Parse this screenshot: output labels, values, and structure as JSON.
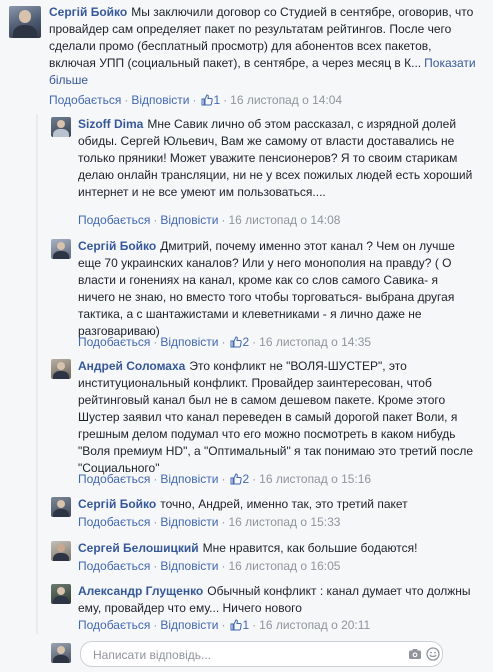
{
  "actions": {
    "like": "Подобається",
    "reply": "Відповісти",
    "separator": "·"
  },
  "comments": [
    {
      "author": "Сергій Бойко",
      "text": "Мы заключили договор со Студией в сентябре, оговорив, что провайдер сам определяет пакет по результатам рейтингов. После чего сделали промо (бесплатный просмотр) для абонентов всех пакетов, включая УПП (социальный пакет), в сентябре, а через месяц в К...",
      "more": "Показати більше",
      "likes": "1",
      "time": "16 листопад о 14:04"
    },
    {
      "author": "Sizoff Dima",
      "text": "Мне Савик лично об этом рассказал, с изрядной долей обиды. Сергей Юльевич, Вам же самому от власти доставались не только пряники! Может уважите пенсионеров? Я то своим старикам делаю онлайн трансляции, ни не у всех пожилых людей есть хороший интернет и не все умеют им пользоваться....",
      "likes": "",
      "time": "16 листопад о 14:08"
    },
    {
      "author": "Сергій Бойко",
      "text": "Дмитрий, почему именно этот канал ? Чем он лучше еще 70 украинских каналов? Или у него монополия на правду? ( О власти и гонениях на канал, кроме как со слов самого Савика- я ничего не знаю, но вместо того чтобы торговаться- выбрана другая тактика, а с шантажистами и клеветниками - я лично даже не разговариваю)",
      "likes": "2",
      "time": "16 листопад о 14:35"
    },
    {
      "author": "Андрей Соломаха",
      "text": "Это конфликт не \"ВОЛЯ-ШУСТЕР\", это институциональный конфликт. Провайдер заинтересован, чтоб рейтинговый канал был не в самом дешевом пакете. Кроме этого Шустер заявил что канал переведен в самый дорогой пакет Воли, я грешным делом подумал что его можно посмотреть в каком нибудь \"Воля премиум HD\", а \"Оптимальный\" я так понимаю это третий после \"Социального\"",
      "likes": "2",
      "time": "16 листопад о 15:16"
    },
    {
      "author": "Сергій Бойко",
      "text": "точно, Андрей, именно так, это третий пакет",
      "likes": "",
      "time": "16 листопад о 15:33"
    },
    {
      "author": "Сергей Белошицкий",
      "text": "Мне нравится, как большие бодаются!",
      "likes": "",
      "time": "16 листопад о 16:05"
    },
    {
      "author": "Александр Глущенко",
      "text": "Обычный конфликт : канал думает что должны ему, провайдер что ему... Ничего нового",
      "likes": "1",
      "time": "16 листопад о 20:11"
    }
  ],
  "reply": {
    "placeholder": "Написати відповідь..."
  },
  "colors": {
    "link": "#365899",
    "action": "#4267b2",
    "meta": "#90949c",
    "background": "#f6f7f9",
    "like_badge": "#5890ff"
  },
  "icons": [
    "thumbs-up-icon",
    "camera-icon",
    "smile-icon"
  ]
}
